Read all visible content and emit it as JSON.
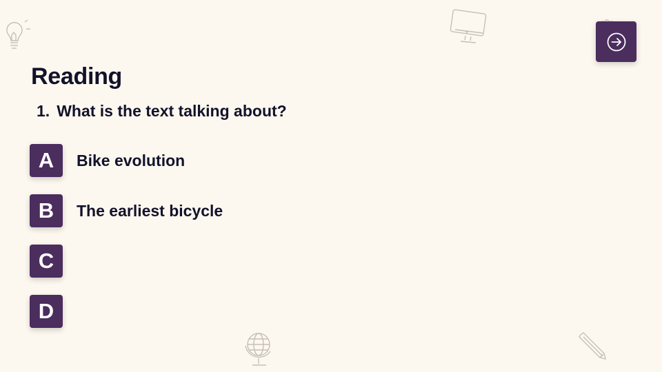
{
  "slide": {
    "title": "Reading",
    "question": {
      "number": "1.",
      "text": "What is the text talking about?"
    },
    "options": [
      {
        "letter": "A",
        "text": "Bike evolution"
      },
      {
        "letter": "B",
        "text": "The earliest bicycle"
      },
      {
        "letter": "C",
        "text": ""
      },
      {
        "letter": "D",
        "text": ""
      }
    ]
  },
  "icons": {
    "next": "arrow-right-circle-icon",
    "decorations": [
      "lightbulb-icon",
      "computer-monitor-icon",
      "gift-icon",
      "globe-icon",
      "pencil-icon"
    ]
  },
  "colors": {
    "background": "#fcf8ef",
    "accent": "#4b2d5e",
    "text": "#13122b",
    "letter": "#ffffff"
  }
}
